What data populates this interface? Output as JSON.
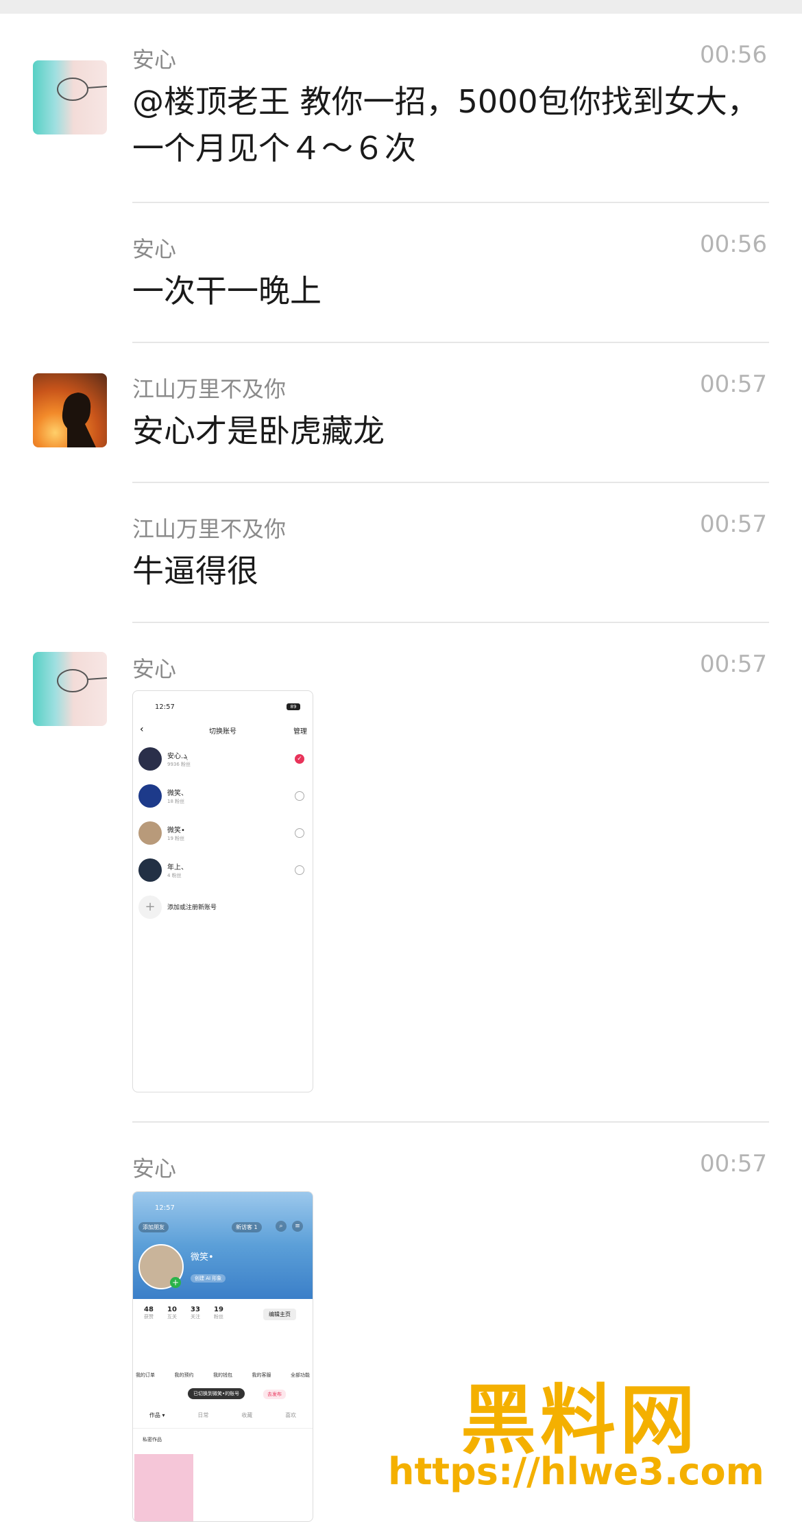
{
  "messages": [
    {
      "sender": "安心",
      "time": "00:56",
      "text_line1": "@楼顶老王 教你一招，5000包你找到女大，",
      "text_line2": "一个月见个４～６次"
    },
    {
      "sender": "安心",
      "time": "00:56",
      "text": "一次干一晚上"
    },
    {
      "sender": "江山万里不及你",
      "time": "00:57",
      "text": "安心才是卧虎藏龙"
    },
    {
      "sender": "江山万里不及你",
      "time": "00:57",
      "text": "牛逼得很"
    },
    {
      "sender": "安心",
      "time": "00:57"
    },
    {
      "sender": "安心",
      "time": "00:57"
    }
  ],
  "shot1": {
    "time": "12:57",
    "battery": "89",
    "title": "切换账号",
    "manage": "管理",
    "accounts": [
      {
        "name": "安心.ܓ",
        "fans": "9936 粉丝"
      },
      {
        "name": "微笑、",
        "fans": "18 粉丝"
      },
      {
        "name": "微笑•",
        "fans": "19 粉丝"
      },
      {
        "name": "年上、",
        "fans": "4 粉丝"
      }
    ],
    "add_label": "添加或注册新账号"
  },
  "shot2": {
    "time": "12:57",
    "add_friend": "添加朋友",
    "visitors": "新访客 1",
    "name": "微笑•",
    "ai": "创建 AI 形象",
    "stats": [
      {
        "num": "48",
        "label": "获赞"
      },
      {
        "num": "10",
        "label": "互关"
      },
      {
        "num": "33",
        "label": "关注"
      },
      {
        "num": "19",
        "label": "粉丝"
      }
    ],
    "edit": "编辑主页",
    "menu": [
      "我的订单",
      "我的预约",
      "我的钱包",
      "我的客服",
      "全部功能"
    ],
    "toast": "已切换到微笑•的账号",
    "publish": "去发布",
    "tabs": [
      "作品 ▾",
      "日常",
      "收藏",
      "喜欢"
    ],
    "private": "私密作品"
  },
  "watermark": {
    "brand": "黑料网",
    "url": "https://hlwe3.com"
  },
  "colors": {
    "check": "#e8335a",
    "sender": "#8a8a8a",
    "time": "#b4b4b4",
    "watermark": "#f4b000"
  }
}
